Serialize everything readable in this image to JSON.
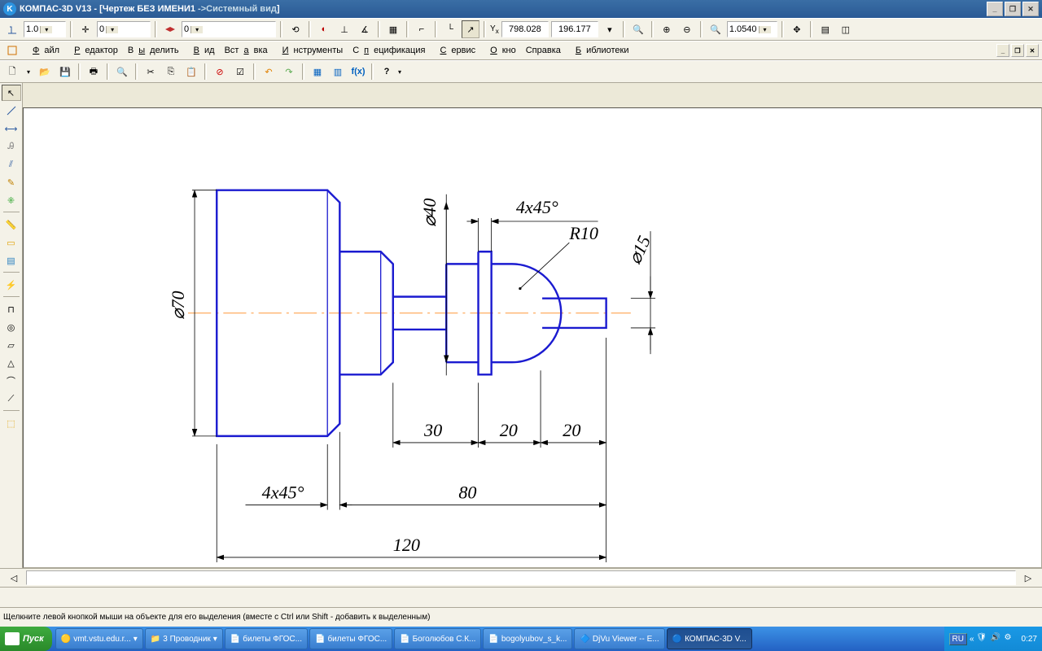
{
  "window": {
    "app": "КОМПАС-3D V13",
    "doc": "Чертеж БЕЗ ИМЕНИ1",
    "view": "Системный вид"
  },
  "topbar": {
    "scale": "1.0",
    "val2": "0",
    "val3": "0",
    "x": "798.028",
    "y": "196.177",
    "zoom": "1.0540"
  },
  "menu": [
    "Файл",
    "Редактор",
    "Выделить",
    "Вид",
    "Вставка",
    "Инструменты",
    "Спецификация",
    "Сервис",
    "Окно",
    "Справка",
    "Библиотеки"
  ],
  "status": "Щелкните левой кнопкой мыши на объекте для его выделения (вместе с Ctrl или Shift - добавить к выделенным)",
  "drawing": {
    "dims": {
      "d70": "⌀70",
      "d40": "⌀40",
      "d15": "⌀15",
      "ch1": "4x45°",
      "ch2": "4x45°",
      "r10": "R10",
      "l30": "30",
      "l20a": "20",
      "l20b": "20",
      "l80": "80",
      "l120": "120"
    }
  },
  "taskbar": {
    "start": "Пуск",
    "tasks": [
      "vmt.vstu.edu.r...",
      "3 Проводник",
      "билеты ФГОС...",
      "билеты ФГОС...",
      "Боголюбов С.К...",
      "bogolyubov_s_k...",
      "DjVu Viewer -- E...",
      "КОМПАС-3D V..."
    ],
    "lang": "RU",
    "clock": "0:27"
  }
}
